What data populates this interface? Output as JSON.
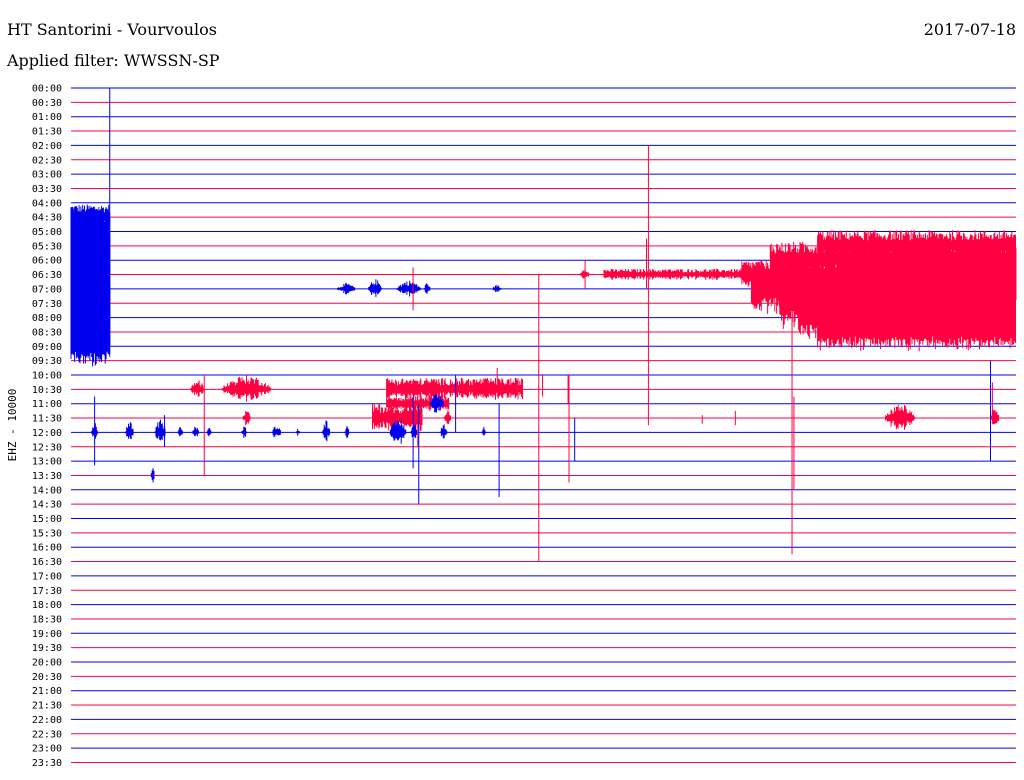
{
  "header": {
    "title": "HT Santorini - Vourvoulos",
    "date": "2017-07-18",
    "filter": "Applied filter: WWSSN-SP"
  },
  "chart_data": {
    "type": "line",
    "title": "HT Santorini - Vourvoulos",
    "ylabel": "EHZ - 10000",
    "colors": {
      "even_hour": "#0000ee",
      "half_hour": "#ff0040"
    },
    "times": [
      "00:00",
      "00:30",
      "01:00",
      "01:30",
      "02:00",
      "02:30",
      "03:00",
      "03:30",
      "04:00",
      "04:30",
      "05:00",
      "05:30",
      "06:00",
      "06:30",
      "07:00",
      "07:30",
      "08:00",
      "08:30",
      "09:00",
      "09:30",
      "10:00",
      "10:30",
      "11:00",
      "11:30",
      "12:00",
      "12:30",
      "13:00",
      "13:30",
      "14:00",
      "14:30",
      "15:00",
      "15:30",
      "16:00",
      "16:30",
      "17:00",
      "17:30",
      "18:00",
      "18:30",
      "19:00",
      "19:30",
      "20:00",
      "20:30",
      "21:00",
      "21:30",
      "22:00",
      "22:30",
      "23:00",
      "23:30"
    ],
    "events": [
      {
        "row": 9,
        "x0": 0.0,
        "x1": 0.041,
        "amp": 0.9,
        "color": "blue",
        "kind": "noise"
      },
      {
        "row": 10,
        "x0": 0.0,
        "x1": 0.041,
        "amp": 1.6,
        "color": "blue",
        "kind": "noise"
      },
      {
        "row": 11,
        "x0": 0.0,
        "x1": 0.041,
        "amp": 1.9,
        "color": "blue",
        "kind": "noise"
      },
      {
        "row": 12,
        "x0": 0.0,
        "x1": 0.041,
        "amp": 2.0,
        "color": "blue",
        "kind": "noise"
      },
      {
        "row": 13,
        "x0": 0.0,
        "x1": 0.041,
        "amp": 2.0,
        "color": "blue",
        "kind": "noise"
      },
      {
        "row": 14,
        "x0": 0.0,
        "x1": 0.041,
        "amp": 2.0,
        "color": "blue",
        "kind": "noise"
      },
      {
        "row": 15,
        "x0": 0.0,
        "x1": 0.041,
        "amp": 2.0,
        "color": "blue",
        "kind": "noise"
      },
      {
        "row": 16,
        "x0": 0.0,
        "x1": 0.041,
        "amp": 2.0,
        "color": "blue",
        "kind": "noise"
      },
      {
        "row": 17,
        "x0": 0.0,
        "x1": 0.041,
        "amp": 2.0,
        "color": "blue",
        "kind": "noise"
      },
      {
        "row": 18,
        "x0": 0.0,
        "x1": 0.041,
        "amp": 1.6,
        "color": "blue",
        "kind": "noise"
      },
      {
        "row": 14,
        "x0": 0.282,
        "x1": 0.301,
        "amp": 0.4,
        "color": "blue",
        "kind": "burst"
      },
      {
        "row": 14,
        "x0": 0.315,
        "x1": 0.329,
        "amp": 0.7,
        "color": "blue",
        "kind": "burst"
      },
      {
        "row": 14,
        "x0": 0.345,
        "x1": 0.37,
        "amp": 0.6,
        "color": "blue",
        "kind": "burst"
      },
      {
        "row": 14,
        "x0": 0.374,
        "x1": 0.38,
        "amp": 0.5,
        "color": "blue",
        "kind": "burst"
      },
      {
        "row": 14,
        "x0": 0.446,
        "x1": 0.455,
        "amp": 0.3,
        "color": "blue",
        "kind": "burst"
      },
      {
        "row": 13,
        "x0": 0.539,
        "x1": 0.548,
        "amp": 0.6,
        "color": "red",
        "kind": "burst"
      },
      {
        "row": 13,
        "x0": 0.564,
        "x1": 0.71,
        "amp": 0.4,
        "color": "red",
        "kind": "noise"
      },
      {
        "row": 13,
        "x0": 0.71,
        "x1": 0.82,
        "amp": 1.0,
        "color": "red",
        "kind": "noise"
      },
      {
        "row": 13,
        "x0": 0.82,
        "x1": 1.0,
        "amp": 1.9,
        "color": "red",
        "kind": "noise"
      },
      {
        "row": 12,
        "x0": 0.74,
        "x1": 1.0,
        "amp": 1.3,
        "color": "red",
        "kind": "noise"
      },
      {
        "row": 11,
        "x0": 0.79,
        "x1": 1.0,
        "amp": 1.1,
        "color": "red",
        "kind": "noise"
      },
      {
        "row": 14,
        "x0": 0.72,
        "x1": 1.0,
        "amp": 1.9,
        "color": "red",
        "kind": "noise"
      },
      {
        "row": 15,
        "x0": 0.75,
        "x1": 1.0,
        "amp": 1.9,
        "color": "red",
        "kind": "noise"
      },
      {
        "row": 16,
        "x0": 0.77,
        "x1": 1.0,
        "amp": 1.8,
        "color": "red",
        "kind": "noise"
      },
      {
        "row": 17,
        "x0": 0.79,
        "x1": 1.0,
        "amp": 1.4,
        "color": "red",
        "kind": "noise"
      },
      {
        "row": 21,
        "x0": 0.127,
        "x1": 0.141,
        "amp": 0.7,
        "color": "red",
        "kind": "burst"
      },
      {
        "row": 21,
        "x0": 0.16,
        "x1": 0.212,
        "amp": 1.0,
        "color": "red",
        "kind": "burst"
      },
      {
        "row": 21,
        "x0": 0.334,
        "x1": 0.478,
        "amp": 0.8,
        "color": "red",
        "kind": "noise"
      },
      {
        "row": 22,
        "x0": 0.334,
        "x1": 0.4,
        "amp": 0.6,
        "color": "red",
        "kind": "noise"
      },
      {
        "row": 23,
        "x0": 0.182,
        "x1": 0.19,
        "amp": 0.6,
        "color": "red",
        "kind": "burst"
      },
      {
        "row": 23,
        "x0": 0.319,
        "x1": 0.372,
        "amp": 1.0,
        "color": "red",
        "kind": "noise"
      },
      {
        "row": 23,
        "x0": 0.395,
        "x1": 0.402,
        "amp": 0.6,
        "color": "red",
        "kind": "burst"
      },
      {
        "row": 23,
        "x0": 0.862,
        "x1": 0.893,
        "amp": 1.0,
        "color": "red",
        "kind": "burst"
      },
      {
        "row": 23,
        "x0": 0.973,
        "x1": 0.982,
        "amp": 0.7,
        "color": "red",
        "kind": "burst"
      },
      {
        "row": 22,
        "x0": 0.38,
        "x1": 0.395,
        "amp": 0.7,
        "color": "blue",
        "kind": "burst"
      },
      {
        "row": 24,
        "x0": 0.022,
        "x1": 0.028,
        "amp": 0.8,
        "color": "blue",
        "kind": "burst"
      },
      {
        "row": 24,
        "x0": 0.058,
        "x1": 0.066,
        "amp": 0.8,
        "color": "blue",
        "kind": "burst"
      },
      {
        "row": 24,
        "x0": 0.089,
        "x1": 0.1,
        "amp": 0.9,
        "color": "blue",
        "kind": "burst"
      },
      {
        "row": 24,
        "x0": 0.113,
        "x1": 0.118,
        "amp": 0.7,
        "color": "blue",
        "kind": "burst"
      },
      {
        "row": 24,
        "x0": 0.129,
        "x1": 0.135,
        "amp": 0.6,
        "color": "blue",
        "kind": "burst"
      },
      {
        "row": 24,
        "x0": 0.144,
        "x1": 0.148,
        "amp": 0.5,
        "color": "blue",
        "kind": "burst"
      },
      {
        "row": 24,
        "x0": 0.181,
        "x1": 0.186,
        "amp": 0.5,
        "color": "blue",
        "kind": "burst"
      },
      {
        "row": 24,
        "x0": 0.213,
        "x1": 0.222,
        "amp": 0.6,
        "color": "blue",
        "kind": "burst"
      },
      {
        "row": 24,
        "x0": 0.238,
        "x1": 0.242,
        "amp": 0.3,
        "color": "blue",
        "kind": "burst"
      },
      {
        "row": 24,
        "x0": 0.266,
        "x1": 0.274,
        "amp": 0.9,
        "color": "blue",
        "kind": "burst"
      },
      {
        "row": 24,
        "x0": 0.29,
        "x1": 0.294,
        "amp": 0.9,
        "color": "blue",
        "kind": "burst"
      },
      {
        "row": 24,
        "x0": 0.338,
        "x1": 0.355,
        "amp": 1.0,
        "color": "blue",
        "kind": "burst"
      },
      {
        "row": 24,
        "x0": 0.36,
        "x1": 0.366,
        "amp": 0.8,
        "color": "blue",
        "kind": "burst"
      },
      {
        "row": 24,
        "x0": 0.391,
        "x1": 0.398,
        "amp": 0.7,
        "color": "blue",
        "kind": "burst"
      },
      {
        "row": 24,
        "x0": 0.435,
        "x1": 0.439,
        "amp": 0.4,
        "color": "blue",
        "kind": "burst"
      },
      {
        "row": 27,
        "x0": 0.085,
        "x1": 0.088,
        "amp": 1.0,
        "color": "blue",
        "kind": "burst"
      }
    ],
    "spikes": [
      {
        "x": 0.041,
        "y0": 0.0,
        "y1": 18.0,
        "color": "blue"
      },
      {
        "x": 0.025,
        "y0": 21.5,
        "y1": 26.3,
        "color": "blue"
      },
      {
        "x": 0.099,
        "y0": 22.8,
        "y1": 25.0,
        "color": "blue"
      },
      {
        "x": 0.141,
        "y0": 20.0,
        "y1": 27.0,
        "color": "red"
      },
      {
        "x": 0.362,
        "y0": 12.5,
        "y1": 15.5,
        "color": "red"
      },
      {
        "x": 0.367,
        "y0": 20.5,
        "y1": 25.0,
        "color": "red"
      },
      {
        "x": 0.362,
        "y0": 21.5,
        "y1": 26.5,
        "color": "blue"
      },
      {
        "x": 0.368,
        "y0": 22.0,
        "y1": 29.0,
        "color": "blue"
      },
      {
        "x": 0.407,
        "y0": 20.0,
        "y1": 24.0,
        "color": "blue"
      },
      {
        "x": 0.451,
        "y0": 19.5,
        "y1": 21.5,
        "color": "red"
      },
      {
        "x": 0.453,
        "y0": 22.0,
        "y1": 28.5,
        "color": "blue"
      },
      {
        "x": 0.495,
        "y0": 13.0,
        "y1": 33.0,
        "color": "red"
      },
      {
        "x": 0.499,
        "y0": 20.0,
        "y1": 21.5,
        "color": "red"
      },
      {
        "x": 0.527,
        "y0": 20.0,
        "y1": 27.5,
        "color": "red"
      },
      {
        "x": 0.526,
        "y0": 20.0,
        "y1": 22.0,
        "color": "red"
      },
      {
        "x": 0.533,
        "y0": 23.0,
        "y1": 26.0,
        "color": "blue"
      },
      {
        "x": 0.544,
        "y0": 12.0,
        "y1": 14.0,
        "color": "red"
      },
      {
        "x": 0.611,
        "y0": 4.0,
        "y1": 23.5,
        "color": "red"
      },
      {
        "x": 0.609,
        "y0": 10.5,
        "y1": 14.0,
        "color": "red"
      },
      {
        "x": 0.703,
        "y0": 22.5,
        "y1": 23.5,
        "color": "red"
      },
      {
        "x": 0.763,
        "y0": 13.5,
        "y1": 32.5,
        "color": "red"
      },
      {
        "x": 0.765,
        "y0": 21.5,
        "y1": 28.0,
        "color": "red"
      },
      {
        "x": 0.973,
        "y0": 19.0,
        "y1": 26.0,
        "color": "blue"
      },
      {
        "x": 0.975,
        "y0": 20.5,
        "y1": 23.0,
        "color": "red"
      },
      {
        "x": 0.668,
        "y0": 22.8,
        "y1": 23.4,
        "color": "red"
      },
      {
        "x": 0.015,
        "y0": 13.9,
        "y1": 14.1,
        "color": "blue"
      },
      {
        "x": 0.021,
        "y0": 13.9,
        "y1": 14.1,
        "color": "blue"
      }
    ]
  }
}
